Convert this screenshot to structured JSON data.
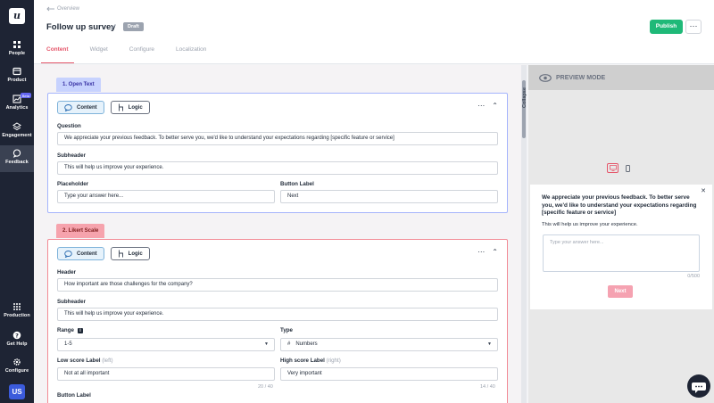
{
  "sidebar": {
    "logo": "u",
    "items": [
      {
        "label": "People"
      },
      {
        "label": "Product"
      },
      {
        "label": "Analytics",
        "badge": "Beta"
      },
      {
        "label": "Engagement"
      },
      {
        "label": "Feedback"
      },
      {
        "label": "Production"
      },
      {
        "label": "Get Help"
      },
      {
        "label": "Configure"
      }
    ],
    "avatar": "US"
  },
  "header": {
    "breadcrumb": "Overview",
    "title": "Follow up survey",
    "status_badge": "Draft",
    "publish_label": "Publish",
    "more_label": "⋯",
    "tabs": [
      {
        "label": "Content",
        "active": true
      },
      {
        "label": "Widget"
      },
      {
        "label": "Configure"
      },
      {
        "label": "Localization"
      }
    ]
  },
  "editor": {
    "q1": {
      "tag": "1. Open Text",
      "content_label": "Content",
      "logic_label": "Logic",
      "question_label": "Question",
      "question_value": "We appreciate your previous feedback. To better serve you, we'd like to understand your expectations regarding [specific feature or service]",
      "subheader_label": "Subheader",
      "subheader_value": "This will help us improve your experience.",
      "placeholder_label": "Placeholder",
      "placeholder_value": "Type your answer here...",
      "button_label_label": "Button Label",
      "button_label_value": "Next"
    },
    "q2": {
      "tag": "2. Likert Scale",
      "content_label": "Content",
      "logic_label": "Logic",
      "header_label": "Header",
      "header_value": "How important are those challenges for the company?",
      "subheader_label": "Subheader",
      "subheader_value": "This will help us improve your experience.",
      "range_label": "Range",
      "range_value": "1-5",
      "type_label": "Type",
      "type_value": "Numbers",
      "low_label": "Low score Label",
      "low_hint": "(left)",
      "low_value": "Not at all important",
      "low_count": "20 / 40",
      "high_label": "High score Label",
      "high_hint": "(right)",
      "high_value": "Very important",
      "high_count": "14 / 40",
      "button_label_label": "Button Label"
    }
  },
  "collapse_label": "Collapse",
  "preview": {
    "mode_label": "PREVIEW MODE",
    "question": "We appreciate your previous feedback. To better serve you, we'd like to understand your expectations regarding [specific feature or service]",
    "subheader": "This will help us improve your experience.",
    "placeholder": "Type your answer here...",
    "counter": "0/500",
    "next_label": "Next"
  },
  "colors": {
    "sidebar": "#1e2434",
    "accent": "#e5566a",
    "publish": "#1fb978",
    "q1_border": "#a5b4fc",
    "q2_border": "#f28b96"
  }
}
